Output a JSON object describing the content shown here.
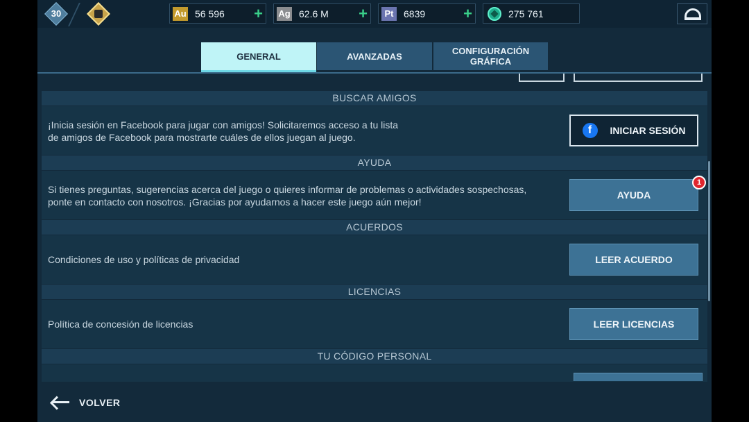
{
  "player": {
    "level": "30"
  },
  "resources": [
    {
      "tag": "Au",
      "value": "56 596",
      "color": "#c39a2d"
    },
    {
      "tag": "Ag",
      "value": "62.6 M",
      "color": "#8b8d90"
    },
    {
      "tag": "Pt",
      "value": "6839",
      "color": "#6b75b0"
    },
    {
      "tag": "",
      "value": "275 761",
      "color": "#1fae8e"
    }
  ],
  "tabs": [
    {
      "label": "GENERAL"
    },
    {
      "label": "AVANZADAS"
    },
    {
      "label": "CONFIGURACIÓN\nGRÁFICA"
    }
  ],
  "sections": {
    "friends": {
      "header": "BUSCAR AMIGOS",
      "text_line1": "¡Inicia sesión en Facebook para jugar con amigos! Solicitaremos acceso a tu lista",
      "text_line2": "de amigos de Facebook para mostrarte cuáles de ellos juegan al juego.",
      "button": "INICIAR SESIÓN",
      "fb_letter": "f"
    },
    "help": {
      "header": "AYUDA",
      "text_line1": "Si tienes preguntas, sugerencias acerca del juego o quieres informar de problemas o actividades sospechosas,",
      "text_line2": "ponte en contacto con nosotros. ¡Gracias por ayudarnos a hacer este juego aún mejor!",
      "button": "AYUDA",
      "badge": "1"
    },
    "agreements": {
      "header": "ACUERDOS",
      "text": "Condiciones de uso y políticas de privacidad",
      "button": "LEER ACUERDO"
    },
    "licenses": {
      "header": "LICENCIAS",
      "text": "Política de concesión de licencias",
      "button": "LEER LICENCIAS"
    },
    "code": {
      "header": "TU CÓDIGO PERSONAL"
    }
  },
  "footer": {
    "back_label": "VOLVER"
  },
  "colors": {
    "background": "#132a3b",
    "header_band": "#1c3d54",
    "button": "#3d7295",
    "active_tab": "#bff4f7",
    "plus": "#39d08a",
    "badge": "#e0262e"
  }
}
